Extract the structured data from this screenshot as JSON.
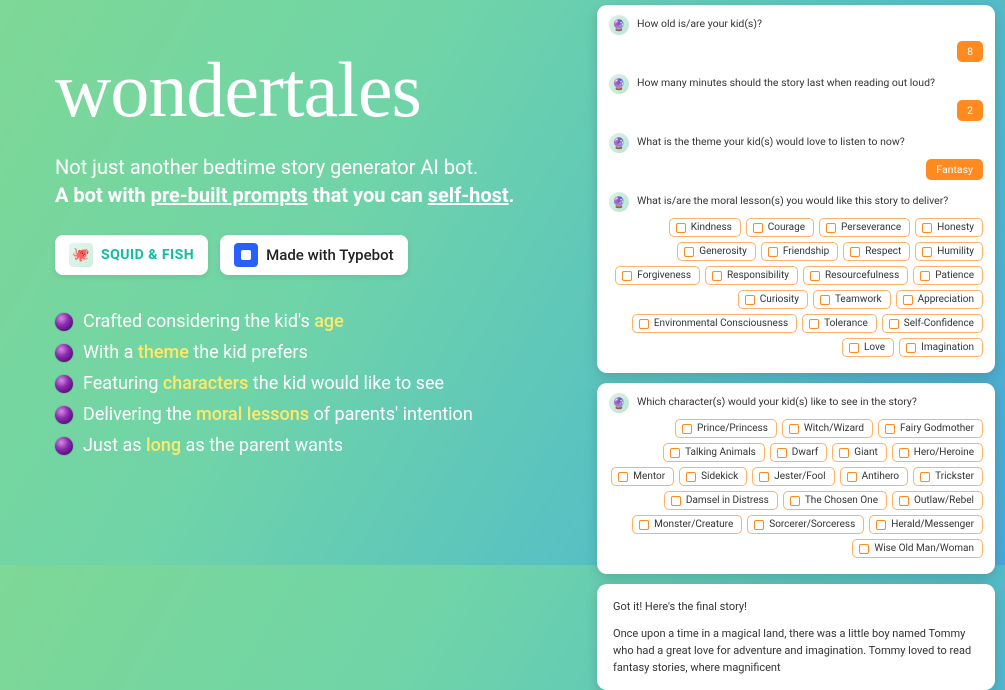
{
  "logo": "wondertales",
  "tagline1": "Not just another bedtime story generator AI bot.",
  "tagline2_prefix": "A bot with ",
  "tagline2_u1": "pre-built prompts",
  "tagline2_mid": " that you can ",
  "tagline2_u2": "self-host",
  "tagline2_suffix": ".",
  "badges": {
    "squid": "SQUID & FISH",
    "typebot": "Made with Typebot"
  },
  "features": [
    {
      "pre": "Crafted considering the kid's ",
      "hl": "age",
      "post": ""
    },
    {
      "pre": "With a ",
      "hl": "theme",
      "post": " the kid prefers"
    },
    {
      "pre": "Featuring ",
      "hl": "characters",
      "post": " the kid would like to see"
    },
    {
      "pre": "Delivering the ",
      "hl": "moral lessons",
      "post": " of parents' intention"
    },
    {
      "pre": "Just as ",
      "hl": "long",
      "post": " as the parent wants"
    }
  ],
  "chat": {
    "q1": "How old is/are your kid(s)?",
    "a1": "8",
    "q2": "How many minutes should the story last when reading out loud?",
    "a2": "2",
    "q3": "What is the theme your kid(s) would love to listen to now?",
    "a3": "Fantasy",
    "q4": "What is/are the moral lesson(s) you would like this story to deliver?",
    "morals": [
      "Kindness",
      "Courage",
      "Perseverance",
      "Honesty",
      "Generosity",
      "Friendship",
      "Respect",
      "Humility",
      "Forgiveness",
      "Responsibility",
      "Resourcefulness",
      "Patience",
      "Curiosity",
      "Teamwork",
      "Appreciation",
      "Environmental Consciousness",
      "Tolerance",
      "Self-Confidence",
      "Love",
      "Imagination"
    ],
    "q5": "Which character(s) would your kid(s) like to see in the story?",
    "characters": [
      "Prince/Princess",
      "Witch/Wizard",
      "Fairy Godmother",
      "Talking Animals",
      "Dwarf",
      "Giant",
      "Hero/Heroine",
      "Mentor",
      "Sidekick",
      "Jester/Fool",
      "Antihero",
      "Trickster",
      "Damsel in Distress",
      "The Chosen One",
      "Outlaw/Rebel",
      "Monster/Creature",
      "Sorcerer/Sorceress",
      "Herald/Messenger",
      "Wise Old Man/Woman"
    ]
  },
  "story": {
    "intro": "Got it! Here's the final story!",
    "body": "Once upon a time in a magical land, there was a little boy named Tommy who had a great love for adventure and imagination. Tommy loved to read fantasy stories, where magnificent"
  }
}
